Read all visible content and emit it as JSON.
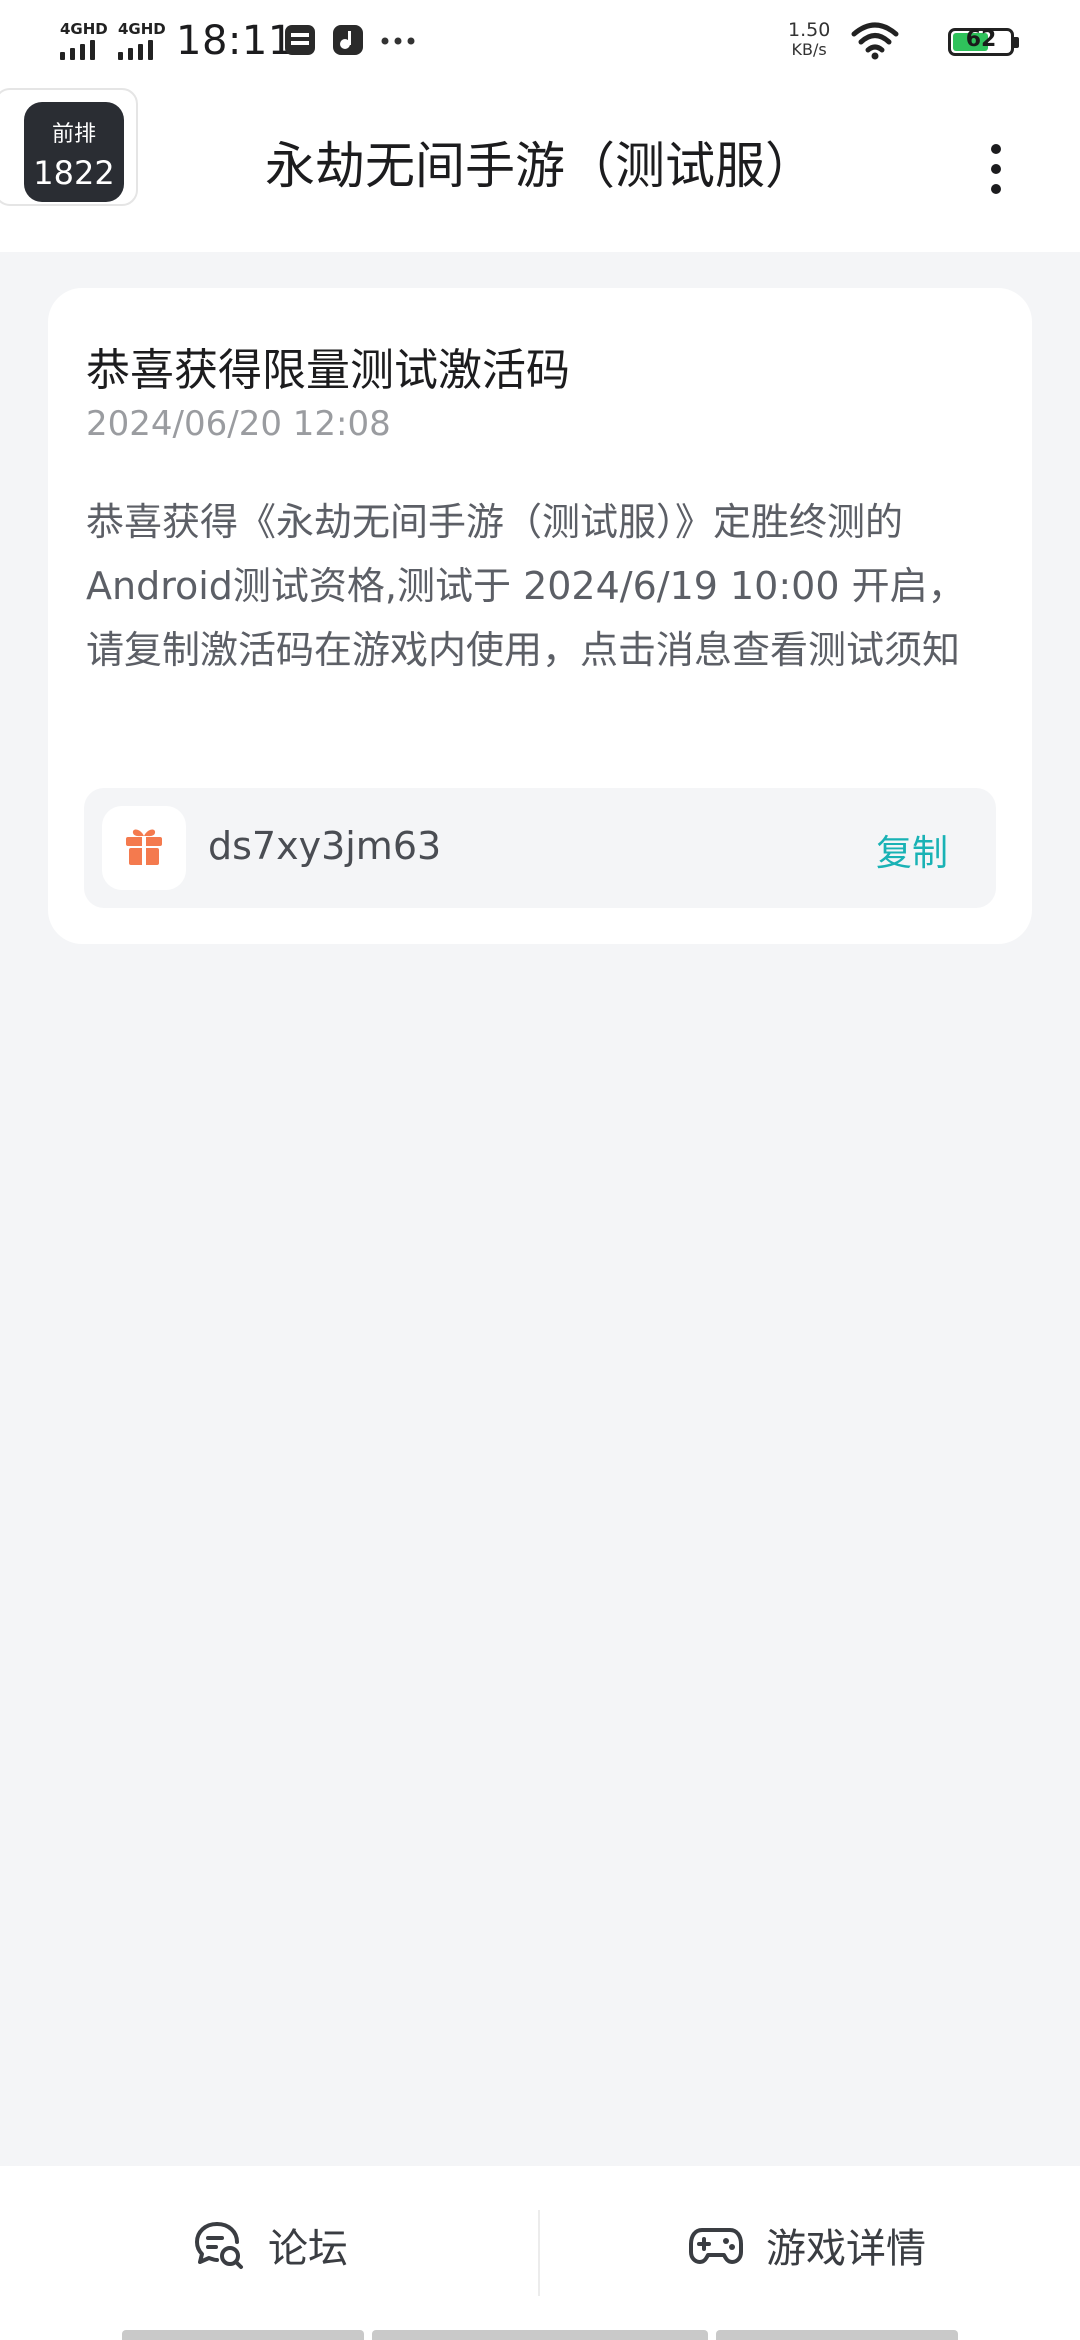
{
  "status_bar": {
    "signal_1": "4GHD",
    "signal_2": "4GHD",
    "time": "18:11",
    "net_speed": "1.50",
    "net_speed_unit": "KB/s",
    "battery_level": "62"
  },
  "header": {
    "rank_label": "前排",
    "rank_number": "1822",
    "title": "永劫无间手游（测试服）"
  },
  "message": {
    "title": "恭喜获得限量测试激活码",
    "timestamp": "2024/06/20 12:08",
    "body": "恭喜获得《永劫无间手游（测试服）》定胜终测的Android测试资格,测试于 2024/6/19 10:00 开启，请复制激活码在游戏内使用，点击消息查看测试须知",
    "activation_code": "ds7xy3jm63",
    "copy_label": "复制"
  },
  "bottom_nav": {
    "forum_label": "论坛",
    "game_detail_label": "游戏详情"
  },
  "colors": {
    "accent": "#19b2b5",
    "gift": "#f47a4e",
    "background": "#f4f5f7"
  }
}
